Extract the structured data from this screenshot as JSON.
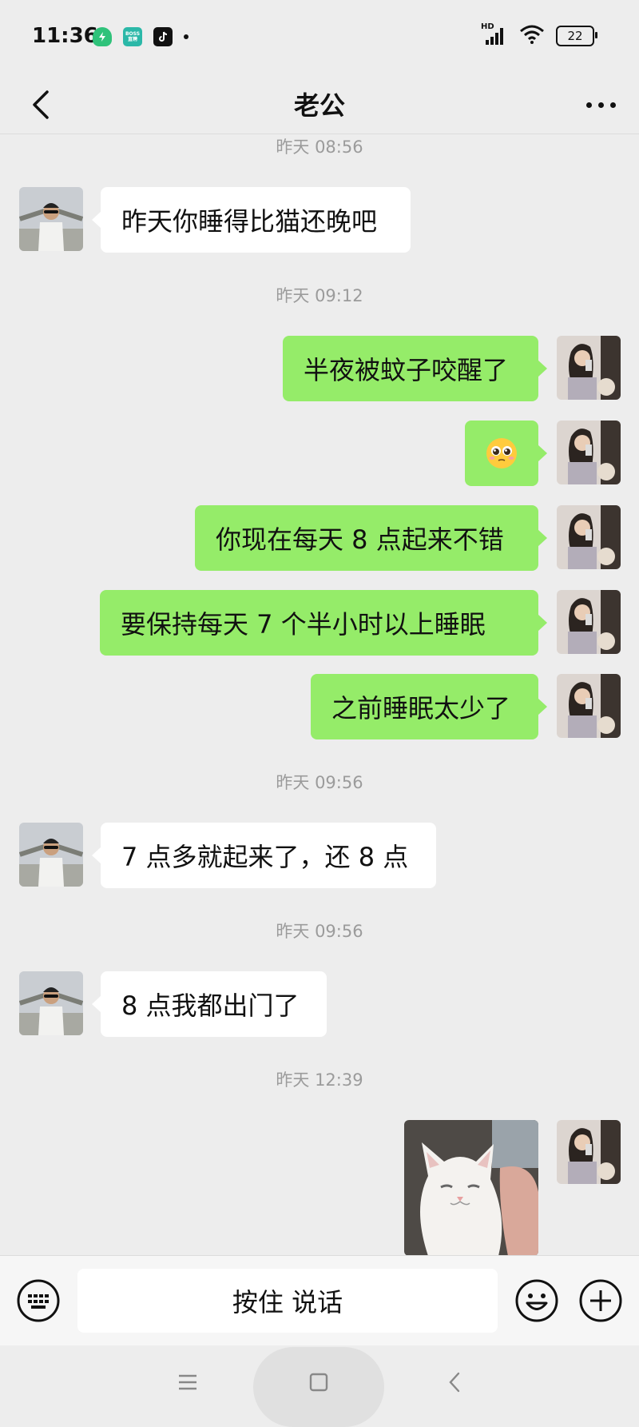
{
  "status": {
    "time": "11:36",
    "app_icon_boss_text": "BOSS直聘",
    "network_label": "HD",
    "battery": "22"
  },
  "header": {
    "title": "老公"
  },
  "messages": [
    {
      "type": "time",
      "text": "昨天 08:56"
    },
    {
      "type": "text",
      "from": "contact",
      "text": "昨天你睡得比猫还晚吧"
    },
    {
      "type": "time",
      "text": "昨天 09:12"
    },
    {
      "type": "text",
      "from": "me",
      "text": "半夜被蚊子咬醒了"
    },
    {
      "type": "emoji",
      "from": "me",
      "emoji": "pleading-face-icon"
    },
    {
      "type": "text",
      "from": "me",
      "text": "你现在每天 8 点起来不错"
    },
    {
      "type": "text",
      "from": "me",
      "text": "要保持每天 7 个半小时以上睡眠"
    },
    {
      "type": "text",
      "from": "me",
      "text": "之前睡眠太少了"
    },
    {
      "type": "time",
      "text": "昨天 09:56"
    },
    {
      "type": "text",
      "from": "contact",
      "text": "7 点多就起来了，还 8 点"
    },
    {
      "type": "time",
      "text": "昨天 09:56"
    },
    {
      "type": "text",
      "from": "contact",
      "text": "8 点我都出门了"
    },
    {
      "type": "time",
      "text": "昨天 12:39"
    },
    {
      "type": "image",
      "from": "me",
      "content": "white-cat-photo"
    }
  ],
  "input_bar": {
    "voice_label": "按住 说话"
  },
  "colors": {
    "background": "#ededed",
    "out_bubble": "#95ec69",
    "in_bubble": "#ffffff"
  }
}
